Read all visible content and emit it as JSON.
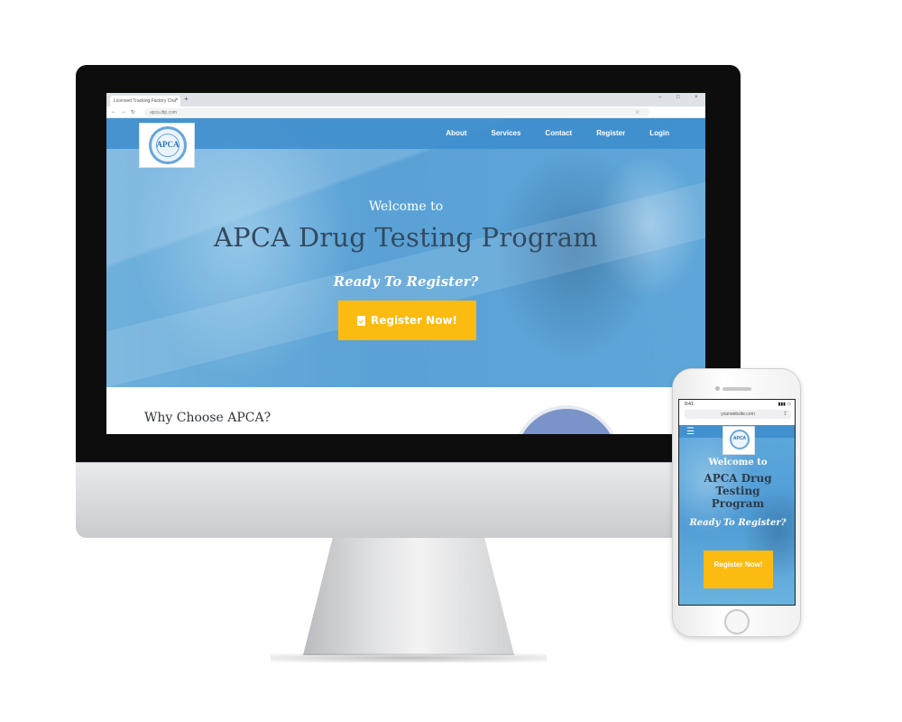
{
  "desktop": {
    "browser": {
      "tab_title": "Licensed Tracking Factory Cha",
      "tab_close": "×",
      "new_tab": "+",
      "window_controls": [
        "–",
        "□",
        "×"
      ],
      "address": "apca.dtp.com"
    },
    "site": {
      "logo_text": "APCA",
      "nav": [
        "About",
        "Services",
        "Contact",
        "Register",
        "Login"
      ],
      "welcome": "Welcome to",
      "title": "APCA Drug Testing Program",
      "subtitle": "Ready To Register?",
      "cta_label": "Register Now!",
      "section_title": "Why Choose APCA?"
    }
  },
  "mobile": {
    "status_time": "9:41",
    "url": "yourwebsite.com",
    "menu_icon": "☰",
    "logo_text": "APCA",
    "welcome": "Welcome to",
    "title": "APCA Drug Testing Program",
    "subtitle": "Ready To Register?",
    "cta_label": "Register Now!"
  },
  "colors": {
    "nav_blue": "#3c8ccd",
    "hero_blue": "#5aa2d6",
    "cta_yellow": "#fcbb11",
    "title_dark": "#34495e"
  },
  "icons": {
    "cta": "clipboard-check-icon",
    "menu": "hamburger-menu-icon",
    "star": "bookmark-star-icon"
  }
}
